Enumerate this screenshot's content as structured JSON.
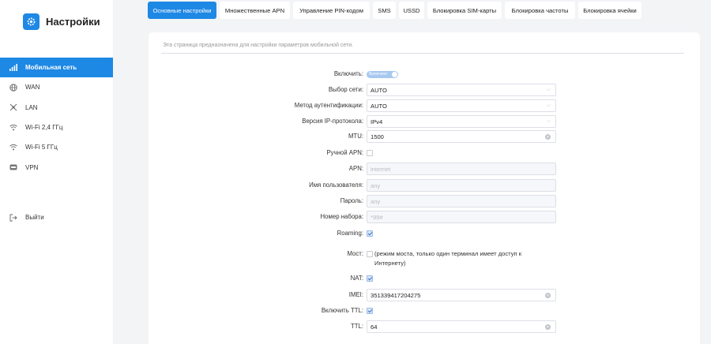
{
  "app": {
    "title": "Настройки",
    "accent": "#1e88e5"
  },
  "sidebar": {
    "items": [
      {
        "label": "Мобильная сеть",
        "icon": "signal-bars-icon",
        "active": true
      },
      {
        "label": "WAN",
        "icon": "globe-icon",
        "active": false
      },
      {
        "label": "LAN",
        "icon": "network-icon",
        "active": false
      },
      {
        "label": "Wi-Fi 2,4 ГГц",
        "icon": "wifi-icon",
        "active": false
      },
      {
        "label": "Wi-Fi 5 ГГц",
        "icon": "wifi-icon",
        "active": false
      },
      {
        "label": "VPN",
        "icon": "vpn-icon",
        "active": false
      }
    ],
    "logout": {
      "label": "Выйти",
      "icon": "logout-icon"
    }
  },
  "tabs": [
    {
      "label": "Основные настройки",
      "active": true
    },
    {
      "label": "Множественные APN",
      "active": false
    },
    {
      "label": "Управление PIN-кодом",
      "active": false
    },
    {
      "label": "SMS",
      "active": false
    },
    {
      "label": "USSD",
      "active": false
    },
    {
      "label": "Блокировка SIM-карты",
      "active": false
    },
    {
      "label": "Блокировка частоты",
      "active": false
    },
    {
      "label": "Блокировка ячейки",
      "active": false
    }
  ],
  "page": {
    "description": "Эта страница предназначена для настройки параметров мобильной сети.",
    "enable": {
      "label": "Включить:",
      "switch_text": "Включено",
      "on": true
    },
    "network": {
      "label": "Выбор сети:",
      "value": "AUTO"
    },
    "auth": {
      "label": "Метод аутентификации:",
      "value": "AUTO"
    },
    "ip_version": {
      "label": "Версия IP-протокола:",
      "value": "IPv4"
    },
    "mtu": {
      "label": "MTU:",
      "value": "1500"
    },
    "manual_apn": {
      "label": "Ручной APN:",
      "checked": false
    },
    "apn": {
      "label": "APN:",
      "placeholder": "internet"
    },
    "username": {
      "label": "Имя пользователя:",
      "placeholder": "any"
    },
    "password": {
      "label": "Пароль:",
      "placeholder": "any"
    },
    "dial_number": {
      "label": "Номер набора:",
      "placeholder": "*99#"
    },
    "roaming": {
      "label": "Roaming:",
      "checked": true
    },
    "bridge": {
      "label": "Мост:",
      "checked": false,
      "note": "(режим моста, только один терминал имеет доступ к Интернету)"
    },
    "nat": {
      "label": "NAT:",
      "checked": true
    },
    "imei": {
      "label": "IMEI:",
      "value": "351339417204275"
    },
    "ttl_enable": {
      "label": "Включить TTL:",
      "checked": true
    },
    "ttl": {
      "label": "TTL:",
      "value": "64"
    }
  }
}
